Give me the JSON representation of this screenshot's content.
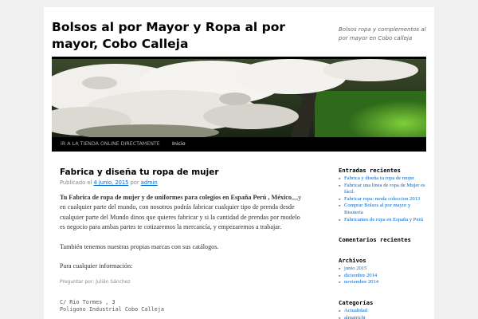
{
  "site": {
    "title": "Bolsos al por Mayor y Ropa al por mayor, Cobo Calleja",
    "description": "Bolsos ropa y complementos al por mayor en Cobo calleja"
  },
  "nav": {
    "items": [
      "IR A LA TIENDA ONLINE DIRECTAMENTE",
      "Inicio"
    ]
  },
  "post": {
    "title": "Fabrica y diseña tu ropa de mujer",
    "meta_published": "Publicado el",
    "meta_date": "4 junio, 2015",
    "meta_by": "por",
    "meta_author": "admin",
    "p1_bold": "Tu Fabrica de ropa de mujer y de uniformes para colegios en España Perú , México",
    "p1_rest": ",,,,y en cualquier parte del mundo, con nosotros podrás fabricar cualquier tipo de prenda  desde cualquier parte del Mundo dinos que quieres fabricar y si la  cantidad de prendas por modelo es negocio para ambas partes te cotizaremos la mercancía, y empezaremos a trabajar.",
    "p2": "También tenemos nuestras propias marcas con sus catálogos.",
    "p3": "Para cualquier información:",
    "asked_by": "Preguntar por: Julián Sánchez",
    "address1": "C/ Rio Tormes , 3",
    "address2": "Poligono Industrial Cobo Calleja"
  },
  "sidebar": {
    "recent_title": "Entradas recientes",
    "recent": [
      "Fabrica y diseña tu ropa de mujer",
      "Fabricar una linea de ropa de Mujer es fácil.",
      "Fabricar ropa: moda coleccion 2013",
      "Comprar Bolsos al por mayor y Bisuteria",
      "Fabricantes de ropa en España y Perú"
    ],
    "comments_title": "Comentarios recientes",
    "archives_title": "Archivos",
    "archives": [
      "junio 2015",
      "diciembre 2014",
      "noviembre 2014"
    ],
    "categories_title": "Categorías",
    "categories": [
      "Actualidad",
      "almatrichi"
    ]
  },
  "colors": {
    "link": "#0066cc",
    "nav_bg": "#000000",
    "page_bg": "#f1f1f1"
  }
}
